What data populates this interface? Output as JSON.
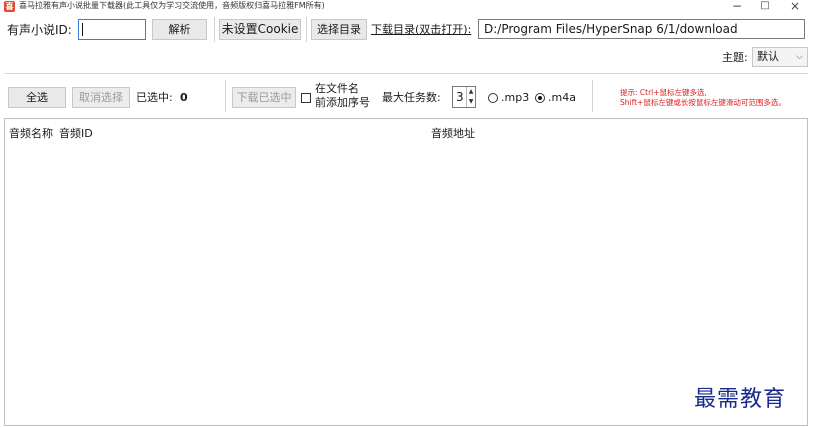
{
  "window": {
    "title": "喜马拉雅有声小说批量下载器(此工具仅为学习交流使用，音频版权归喜马拉雅FM所有)",
    "app_icon": "喜",
    "minimize": "−",
    "maximize": "□",
    "close": "×"
  },
  "toolbar": {
    "novel_id_label": "有声小说ID:",
    "novel_id_value": "",
    "parse_button": "解析",
    "cookie_button": "未设置Cookie",
    "choose_dir_button": "选择目录",
    "download_dir_link": "下载目录(双击打开):",
    "download_dir_value": "D:/Program Files/HyperSnap 6/1/download"
  },
  "theme": {
    "label": "主题:",
    "selected": "默认",
    "chevron": "⌵"
  },
  "actions": {
    "select_all": "全选",
    "deselect": "取消选择",
    "selected_label": "已选中:",
    "selected_count": "0",
    "download_selected": "下载已选中",
    "prefix_checkbox_line1": "在文件名",
    "prefix_checkbox_line2": "前添加序号",
    "max_tasks_label": "最大任务数:",
    "max_tasks_value": "3",
    "format_mp3": ".mp3",
    "format_m4a": ".m4a",
    "format_selected": ".m4a"
  },
  "hint": {
    "line1": "提示: Ctrl+鼠标左键多选,",
    "line2": "Shift+鼠标左键或长按鼠标左键滑动可范围多选。"
  },
  "table": {
    "columns": [
      "音频名称",
      "音频ID",
      "音频地址"
    ]
  },
  "watermark": "最需教育"
}
